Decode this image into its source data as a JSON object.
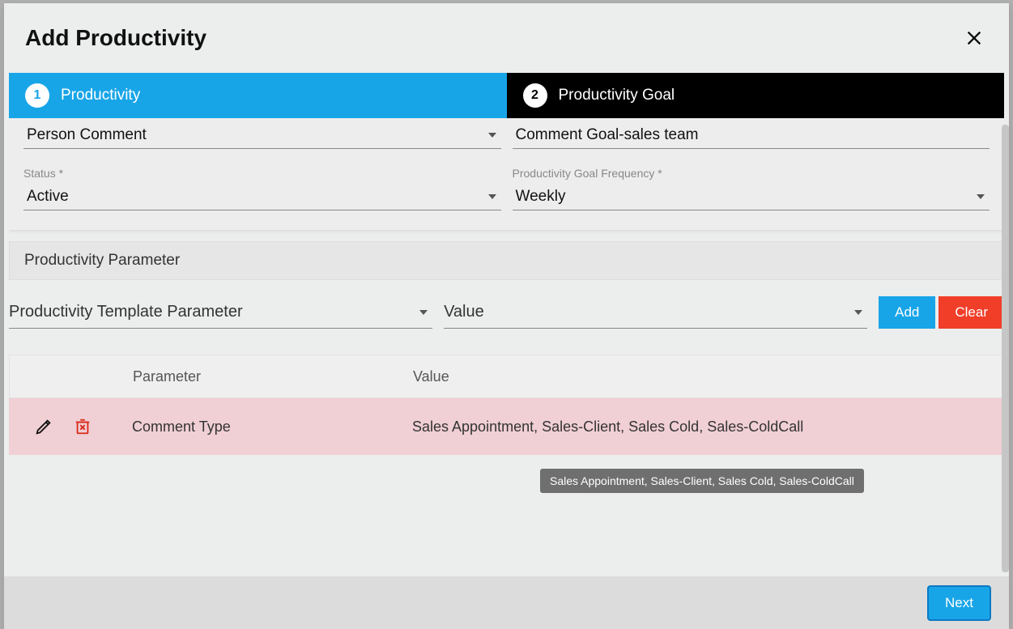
{
  "modal": {
    "title": "Add Productivity"
  },
  "steps": [
    {
      "num": "1",
      "label": "Productivity",
      "active": true
    },
    {
      "num": "2",
      "label": "Productivity Goal",
      "active": false
    }
  ],
  "form": {
    "field1": {
      "value": "Person Comment"
    },
    "field2": {
      "value": "Comment Goal-sales team"
    },
    "status": {
      "label": "Status *",
      "value": "Active"
    },
    "goalFreq": {
      "label": "Productivity Goal Frequency *",
      "value": "Weekly"
    }
  },
  "section": {
    "title": "Productivity Parameter"
  },
  "paramAdd": {
    "templateParam": {
      "placeholder": "Productivity Template Parameter"
    },
    "value": {
      "placeholder": "Value"
    },
    "addLabel": "Add",
    "clearLabel": "Clear"
  },
  "table": {
    "headers": {
      "parameter": "Parameter",
      "value": "Value"
    },
    "rows": [
      {
        "parameter": "Comment Type",
        "value": "Sales Appointment, Sales-Client, Sales Cold, Sales-ColdCall"
      }
    ]
  },
  "tooltip": {
    "text": "Sales Appointment, Sales-Client, Sales Cold, Sales-ColdCall"
  },
  "footer": {
    "nextLabel": "Next"
  }
}
